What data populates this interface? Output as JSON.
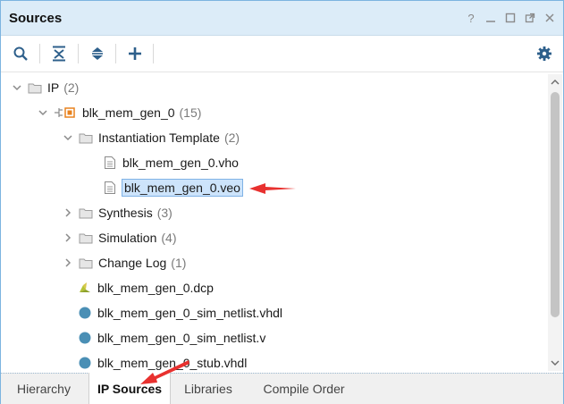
{
  "window": {
    "title": "Sources",
    "controls": [
      "help-icon",
      "minimize-icon",
      "restore-icon",
      "float-icon",
      "close-icon"
    ]
  },
  "toolbar": {
    "buttons": [
      "search-icon",
      "collapse-all-icon",
      "expand-all-icon",
      "add-icon"
    ],
    "settings": "gear-icon"
  },
  "tree": {
    "ip": {
      "label": "IP",
      "count": "(2)"
    },
    "core": {
      "label": "blk_mem_gen_0",
      "count": "(15)"
    },
    "instantiation": {
      "label": "Instantiation Template",
      "count": "(2)"
    },
    "vho": {
      "label": "blk_mem_gen_0.vho"
    },
    "veo": {
      "label": "blk_mem_gen_0.veo"
    },
    "synthesis": {
      "label": "Synthesis",
      "count": "(3)"
    },
    "simulation": {
      "label": "Simulation",
      "count": "(4)"
    },
    "changelog": {
      "label": "Change Log",
      "count": "(1)"
    },
    "dcp": {
      "label": "blk_mem_gen_0.dcp"
    },
    "sim_vhdl": {
      "label": "blk_mem_gen_0_sim_netlist.vhdl"
    },
    "sim_v": {
      "label": "blk_mem_gen_0_sim_netlist.v"
    },
    "stub_vhdl": {
      "label": "blk_mem_gen_0_stub.vhdl"
    }
  },
  "tabs": [
    {
      "label": "Hierarchy",
      "active": false
    },
    {
      "label": "IP Sources",
      "active": true
    },
    {
      "label": "Libraries",
      "active": false
    },
    {
      "label": "Compile Order",
      "active": false
    }
  ],
  "colors": {
    "accent": "#7cb4e0",
    "titlebar": "#dcecf8",
    "selection": "#cde4fb",
    "annotation_arrow": "#e8312f",
    "file_dot": "#4a8fb5",
    "core_icon": "#e8821e"
  }
}
